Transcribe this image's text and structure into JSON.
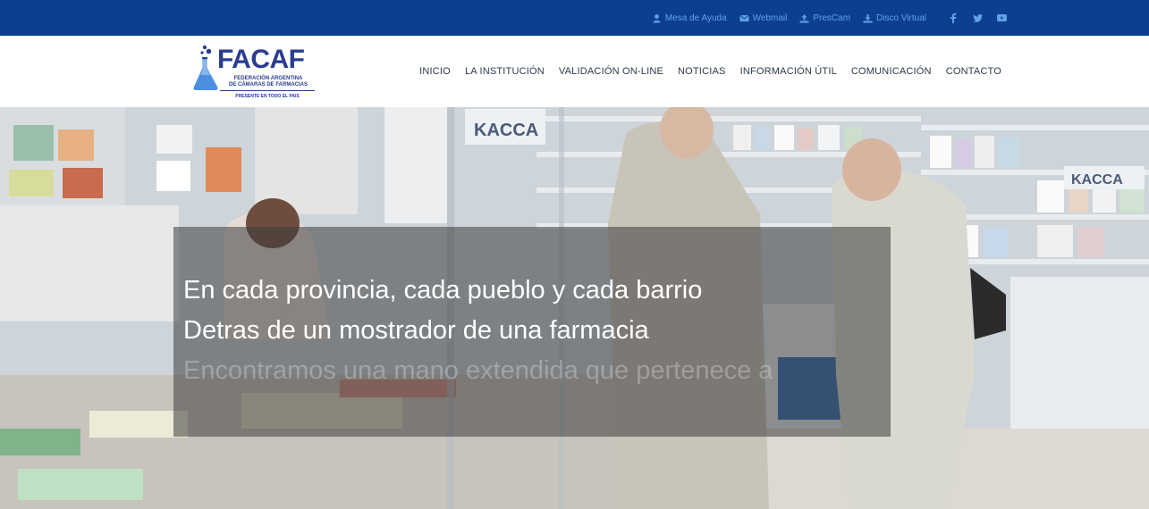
{
  "topbar": {
    "links": [
      {
        "label": "Mesa de Ayuda",
        "icon": "headset-icon"
      },
      {
        "label": "Webmail",
        "icon": "envelope-icon"
      },
      {
        "label": "PresCam",
        "icon": "upload-icon"
      },
      {
        "label": "Disco Virtual",
        "icon": "download-icon"
      }
    ],
    "social": [
      "facebook-icon",
      "twitter-icon",
      "youtube-icon"
    ],
    "bg_color": "#0e3e8f",
    "link_color": "#5fa3e6"
  },
  "logo": {
    "name": "FACAF",
    "subtitle_line1": "FEDERACIÓN ARGENTINA",
    "subtitle_line2": "DE CÁMARAS DE FARMACIAS",
    "tagline": "PRESENTE EN TODO EL PAIS"
  },
  "nav": {
    "items": [
      "INICIO",
      "LA INSTITUCIÓN",
      "VALIDACIÓN ON-LINE",
      "NOTICIAS",
      "INFORMACIÓN ÚTIL",
      "COMUNICACIÓN",
      "CONTACTO"
    ]
  },
  "hero": {
    "line1": "En cada provincia, cada pueblo y cada barrio",
    "line2": "Detras de un mostrador de una farmacia",
    "line3": "Encontramos una mano extendida que pertenece a"
  }
}
